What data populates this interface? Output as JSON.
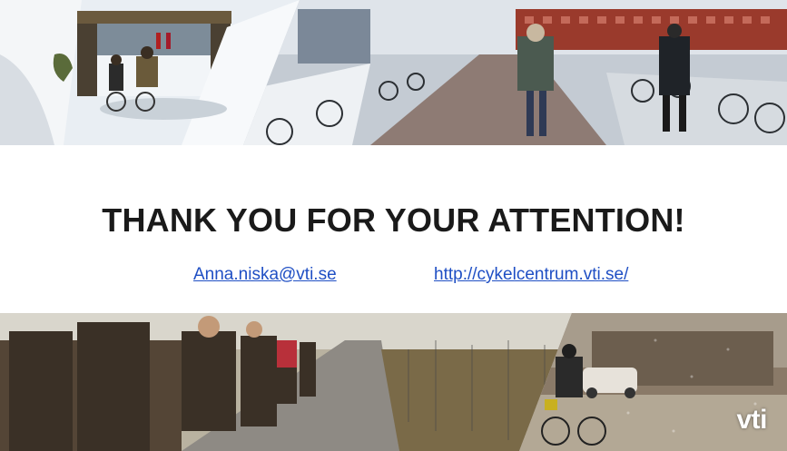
{
  "slide": {
    "title": "THANK YOU FOR YOUR ATTENTION!",
    "email": "Anna.niska@vti.se",
    "website": "http://cykelcentrum.vti.se/",
    "logo": "vti"
  },
  "photos": [
    {
      "name": "underpass-cyclists-photo"
    },
    {
      "name": "campus-bike-parking-photo"
    },
    {
      "name": "group-cycling-road-photo"
    },
    {
      "name": "snowy-street-cyclist-photo"
    }
  ],
  "colors": {
    "link": "#1f4fc4",
    "title": "#1a1a1a"
  }
}
